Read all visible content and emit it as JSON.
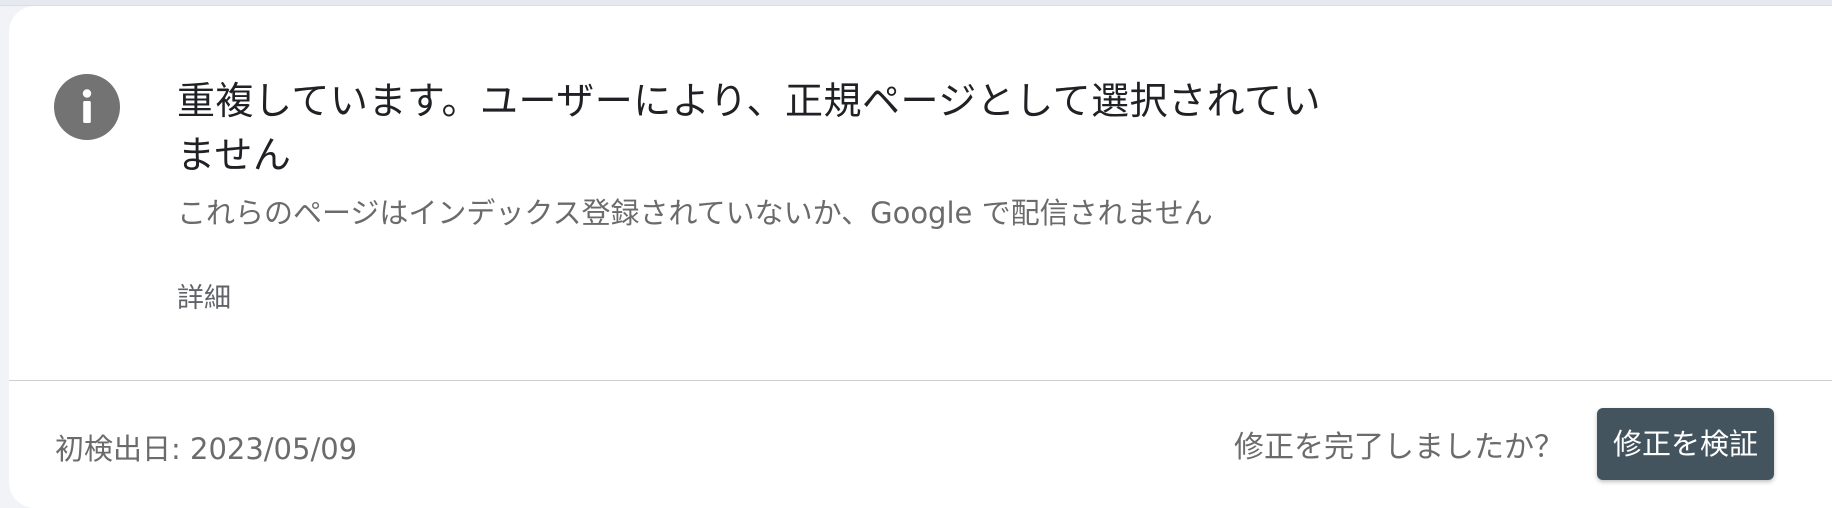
{
  "issue": {
    "title": "重複しています。ユーザーにより、正規ページとして選択されていません",
    "description": "これらのページはインデックス登録されていないか、Google で配信されません",
    "details_link": "詳細",
    "icon": "info-icon"
  },
  "footer": {
    "first_detected": "初検出日: 2023/05/09",
    "fix_question": "修正を完了しましたか？",
    "validate_button": "修正を検証"
  },
  "colors": {
    "card_background": "#ffffff",
    "page_background": "#f1f3f7",
    "icon": "#737373",
    "button": "#44545f"
  }
}
